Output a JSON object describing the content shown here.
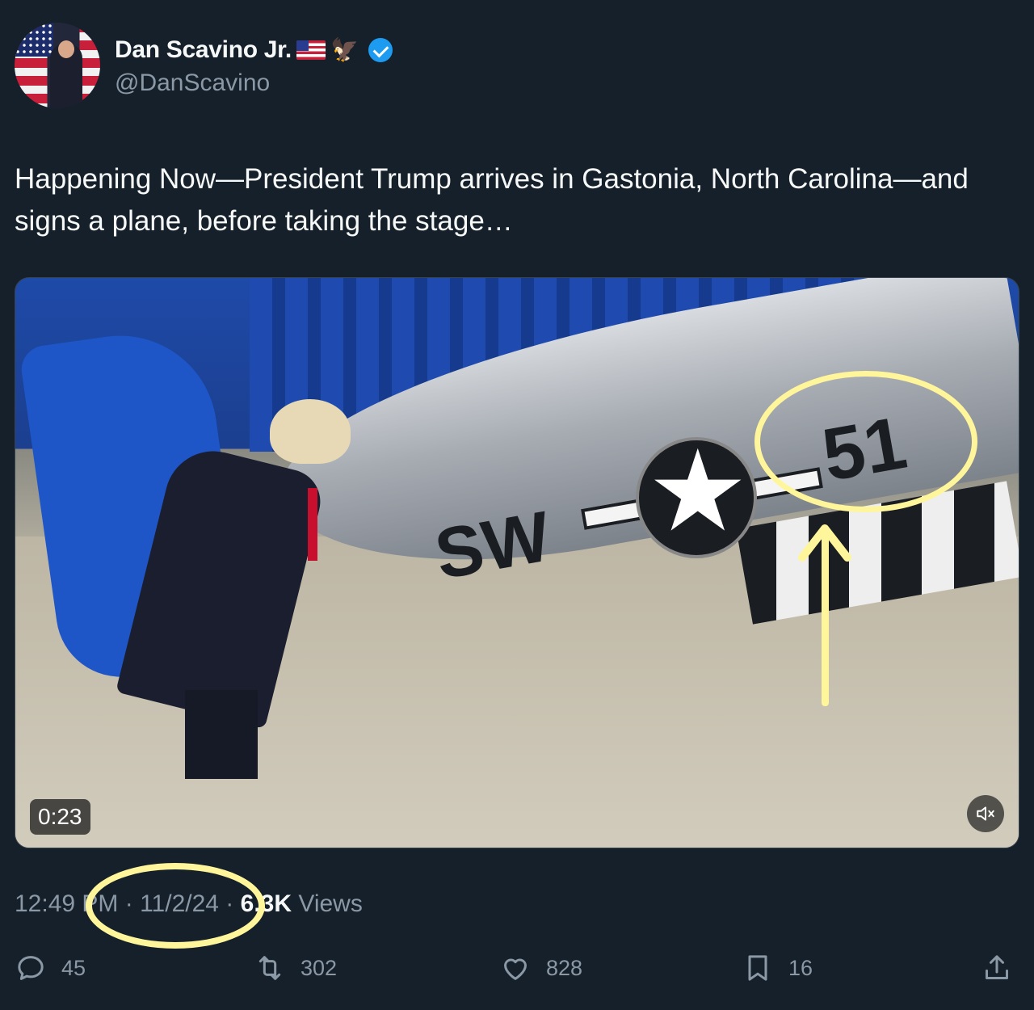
{
  "author": {
    "display_name": "Dan Scavino Jr.",
    "handle": "@DanScavino",
    "verified_color": "#1d9bf0",
    "name_emojis": [
      "us-flag-icon",
      "eagle-icon"
    ]
  },
  "tweet": {
    "text": "Happening Now—President Trump arrives in Gastonia, North Carolina—and signs a plane, before taking the stage…"
  },
  "media": {
    "type": "video",
    "duration": "0:23",
    "plane_code_left": "SW",
    "plane_code_right": "51",
    "muted": true
  },
  "meta": {
    "time": "12:49 PM",
    "separator": " · ",
    "date": "11/2/24",
    "views_count": "6.3K",
    "views_label": " Views"
  },
  "actions": {
    "replies": "45",
    "reposts": "302",
    "likes": "828",
    "bookmarks": "16"
  },
  "annotation_color": "#fff59a"
}
